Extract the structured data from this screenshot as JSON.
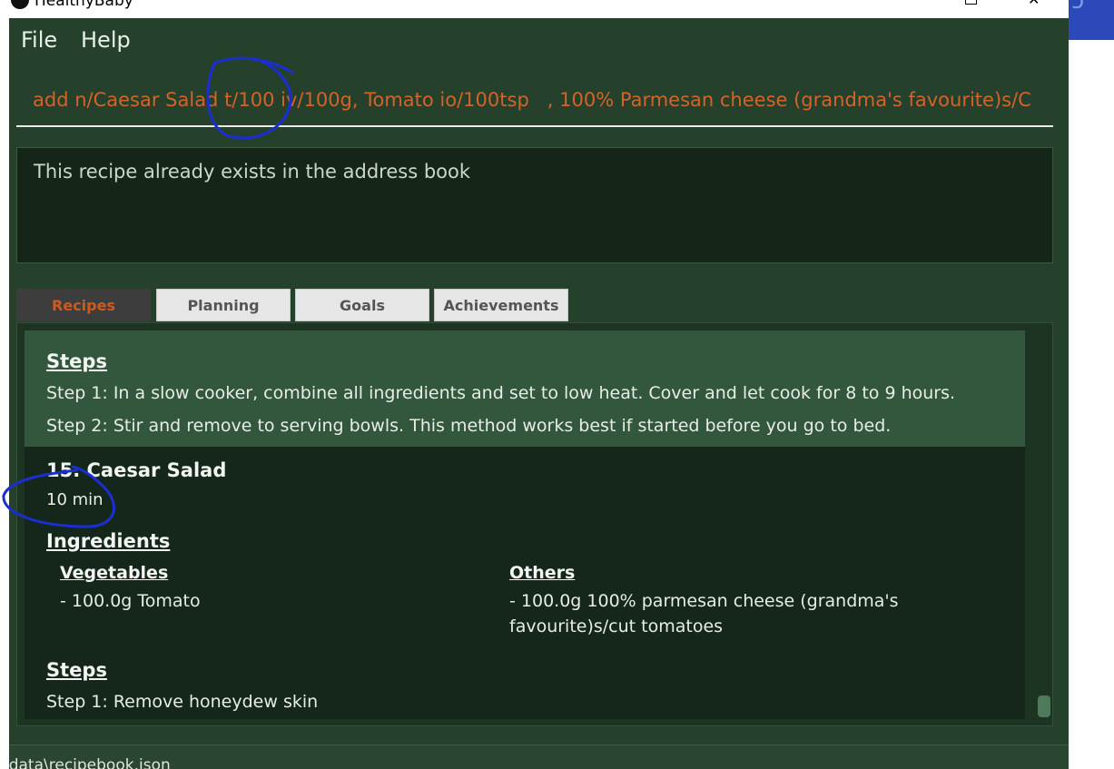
{
  "window": {
    "title": "HealthyBaby"
  },
  "menu": {
    "file": "File",
    "help": "Help"
  },
  "command": {
    "value": "add n/Caesar Salad t/100 iv/100g, Tomato io/100tsp   , 100% Parmesan cheese (grandma's favourite)s/C"
  },
  "result": {
    "message": "This recipe already exists in the address book"
  },
  "tabs": [
    {
      "label": "Recipes",
      "active": true
    },
    {
      "label": "Planning",
      "active": false
    },
    {
      "label": "Goals",
      "active": false
    },
    {
      "label": "Achievements",
      "active": false
    }
  ],
  "recipes": {
    "previous": {
      "steps_heading": "Steps",
      "steps": [
        "Step 1: In a slow cooker, combine all ingredients and set to low heat. Cover and let cook for 8 to 9 hours.",
        "Step 2: Stir and remove to serving bowls. This method works best if started before you go to bed."
      ]
    },
    "current": {
      "name": "15.   Caesar Salad",
      "time": "10 min",
      "ingredients_heading": "Ingredients",
      "vegetables_heading": "Vegetables",
      "vegetables": [
        "- 100.0g Tomato"
      ],
      "others_heading": "Others",
      "others": [
        "- 100.0g 100% parmesan cheese (grandma's",
        "favourite)s/cut tomatoes"
      ],
      "steps_heading": "Steps",
      "steps": [
        "Step 1: Remove honeydew skin"
      ]
    }
  },
  "status": {
    "path": "\\data\\recipebook.json"
  },
  "annotation_color": "#1a2fd1",
  "accent_orange": "#d2642a"
}
